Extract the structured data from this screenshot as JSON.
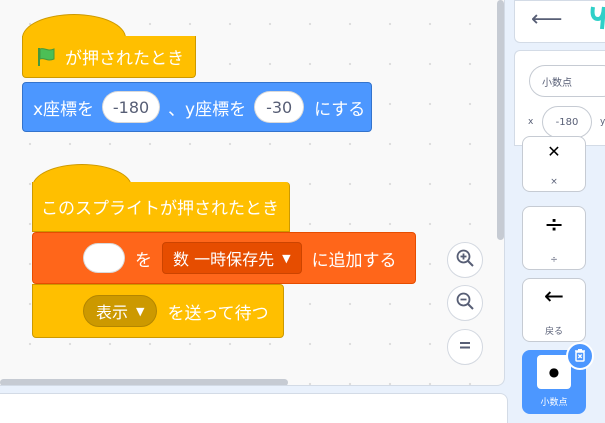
{
  "script1": {
    "hat_label": "が押されたとき",
    "motion_label_x": "x座標を",
    "x_value": "-180",
    "motion_label_y": "、y座標を",
    "y_value": "-30",
    "motion_label_end": "にする"
  },
  "script2": {
    "hat_label": "このスプライトが押されたとき",
    "list_label_wo": "を",
    "list_name": "数 一時保存先",
    "list_label_end": "に追加する",
    "broadcast_name": "表示",
    "broadcast_label": "を送って待つ"
  },
  "zoom": {
    "in_icon": "zoom-in-icon",
    "out_icon": "zoom-out-icon",
    "reset_icon": "zoom-reset-icon"
  },
  "sprite_info": {
    "name": "小数点",
    "x_label": "x",
    "x_value": "-180",
    "y_label": "y"
  },
  "costumes": [
    {
      "name": "×",
      "glyph": "✕"
    },
    {
      "name": "÷",
      "glyph": "÷"
    },
    {
      "name": "戻る",
      "glyph": "←"
    },
    {
      "name": "小数点",
      "glyph": "●"
    }
  ],
  "colors": {
    "events": "#ffbf00",
    "motion": "#4c97ff",
    "data_list": "#ff661a",
    "flag": "#4cbf56"
  }
}
